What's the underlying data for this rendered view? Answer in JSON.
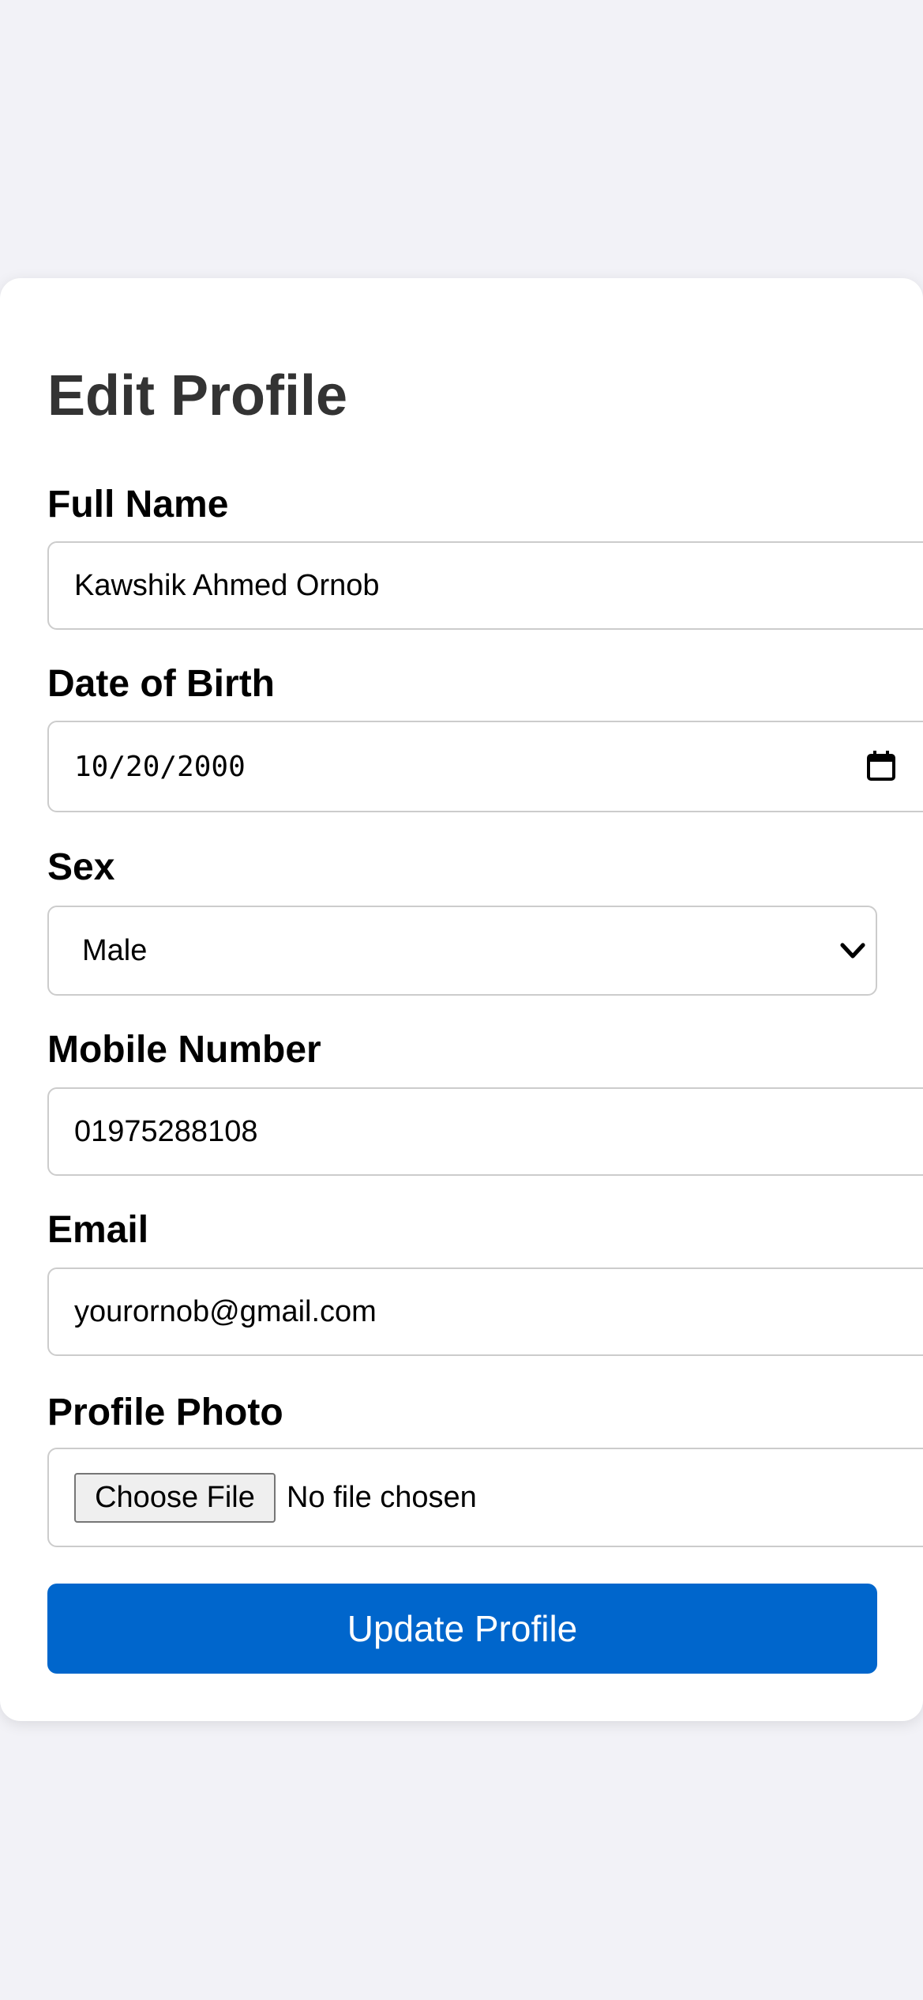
{
  "page": {
    "title": "Edit Profile"
  },
  "form": {
    "full_name": {
      "label": "Full Name",
      "value": "Kawshik Ahmed Ornob"
    },
    "date_of_birth": {
      "label": "Date of Birth",
      "value": "10/20/2000",
      "icon": "calendar-icon"
    },
    "sex": {
      "label": "Sex",
      "selected": "Male",
      "icon": "chevron-down-icon"
    },
    "mobile_number": {
      "label": "Mobile Number",
      "value": "01975288108"
    },
    "email": {
      "label": "Email",
      "value": "yourornob@gmail.com"
    },
    "profile_photo": {
      "label": "Profile Photo",
      "button_label": "Choose File",
      "status": "No file chosen"
    },
    "submit_label": "Update Profile"
  },
  "colors": {
    "page_background": "#f2f2f7",
    "card_background": "#ffffff",
    "primary_button": "#0066cc",
    "title_text": "#333333",
    "field_border": "#cccccc"
  }
}
